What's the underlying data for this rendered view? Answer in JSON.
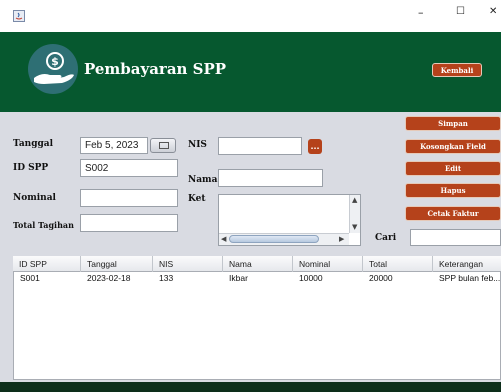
{
  "window": {
    "minimize": "–",
    "maximize": "☐",
    "close": "✕"
  },
  "header": {
    "title": "Pembayaran SPP",
    "logo_icon": "money-hand-icon",
    "kembali": "Kembali",
    "bg_color": "#06582f"
  },
  "form": {
    "tanggal_label": "Tanggal",
    "tanggal_value": "Feb 5, 2023",
    "id_spp_label": "ID SPP",
    "id_spp_value": "S002",
    "nominal_label": "Nominal",
    "nominal_value": "",
    "total_label": "Total Tagihan",
    "total_value": "",
    "nis_label": "NIS",
    "nis_value": "",
    "nis_button": "...",
    "nama_label": "Nama",
    "nama_value": "",
    "ket_label": "Ket",
    "ket_value": "",
    "cari_label": "Cari",
    "cari_value": ""
  },
  "buttons": {
    "simpan": "Simpan",
    "kosongkan": "Kosongkan Field",
    "edit": "Edit",
    "hapus": "Hapus",
    "cetak": "Cetak Faktur",
    "accent": "#b5421b"
  },
  "table": {
    "columns": [
      "ID SPP",
      "Tanggal",
      "NIS",
      "Nama",
      "Nominal",
      "Total",
      "Keterangan"
    ],
    "rows": [
      [
        "S001",
        "2023-02-18",
        "133",
        "Ikbar",
        "10000",
        "20000",
        "SPP bulan feb..."
      ]
    ]
  }
}
